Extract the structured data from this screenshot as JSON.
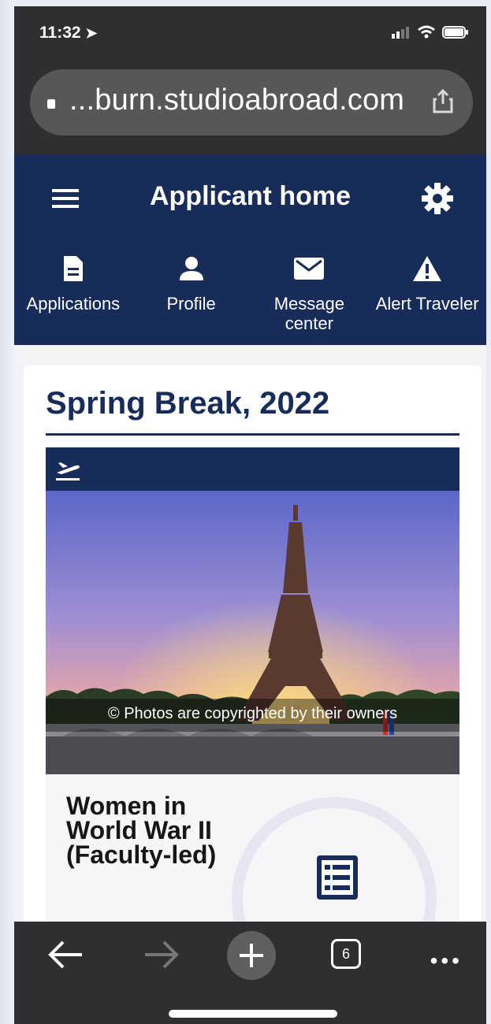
{
  "status_bar": {
    "time": "11:32"
  },
  "browser": {
    "url": "...burn.studioabroad.com",
    "tabs_count": "6"
  },
  "app": {
    "title": "Applicant home",
    "nav": [
      {
        "label": "Applications",
        "icon": "document-icon"
      },
      {
        "label": "Profile",
        "icon": "person-icon"
      },
      {
        "label": "Message center",
        "icon": "envelope-icon"
      },
      {
        "label": "Alert Traveler",
        "icon": "warning-icon"
      }
    ]
  },
  "section": {
    "title": "Spring Break, 2022",
    "trip": {
      "caption": "© Photos are copyrighted by their owners",
      "title": "Women in World War II (Faculty-led)"
    }
  },
  "colors": {
    "navy": "#172c58",
    "browser_chrome": "#2f2f31"
  }
}
